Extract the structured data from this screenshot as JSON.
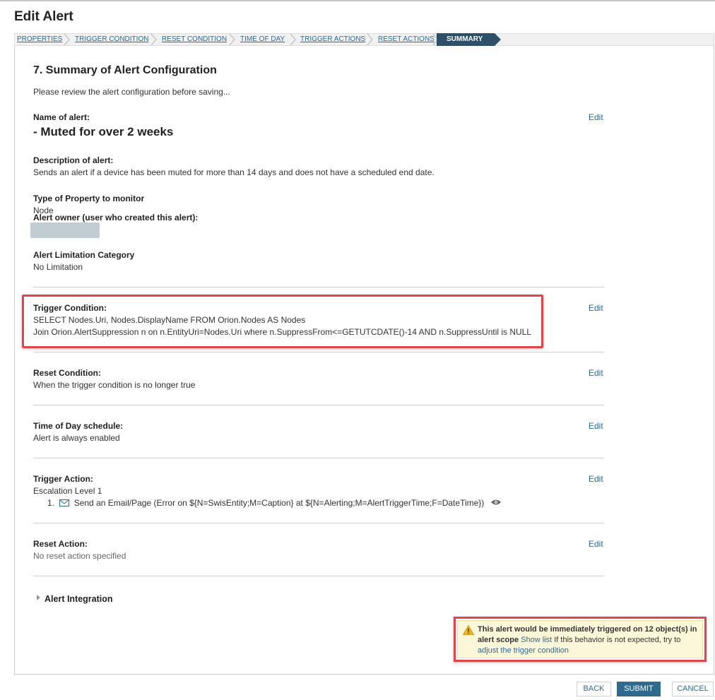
{
  "page": {
    "title": "Edit Alert"
  },
  "wizard": {
    "steps": [
      "PROPERTIES",
      "TRIGGER CONDITION",
      "RESET CONDITION",
      "TIME OF DAY",
      "TRIGGER ACTIONS",
      "RESET ACTIONS",
      "SUMMARY"
    ],
    "active_step": "SUMMARY"
  },
  "summary": {
    "heading": "7. Summary of Alert Configuration",
    "intro": "Please review the alert configuration before saving...",
    "edit_label": "Edit",
    "name": {
      "label": "Name of alert:",
      "value": "- Muted for over 2 weeks"
    },
    "description": {
      "label": "Description of alert:",
      "value": "Sends an alert if a device has been muted for more than 14 days and does not have a scheduled end date."
    },
    "property_type": {
      "label": "Type of Property to monitor",
      "value": "Node"
    },
    "owner": {
      "label": "Alert owner (user who created this alert):"
    },
    "limitation": {
      "label": "Alert Limitation Category",
      "value": "No Limitation"
    },
    "trigger_condition": {
      "label": "Trigger Condition:",
      "line1": "SELECT Nodes.Uri, Nodes.DisplayName FROM Orion.Nodes AS Nodes",
      "line2": "Join Orion.AlertSuppression n on n.EntityUri=Nodes.Uri where n.SuppressFrom<=GETUTCDATE()-14 AND n.SuppressUntil is NULL"
    },
    "reset_condition": {
      "label": "Reset Condition:",
      "value": "When the trigger condition is no longer true"
    },
    "time_of_day": {
      "label": "Time of Day schedule:",
      "value": "Alert is always enabled"
    },
    "trigger_action": {
      "label": "Trigger Action:",
      "level": "Escalation Level 1",
      "item_number": "1.",
      "item_text": "Send an Email/Page (Error on ${N=SwisEntity;M=Caption} at ${N=Alerting;M=AlertTriggerTime;F=DateTime})"
    },
    "reset_action": {
      "label": "Reset Action:",
      "value": "No reset action specified"
    },
    "integration": {
      "label": "Alert Integration"
    }
  },
  "warning": {
    "bold_text": "This alert would be immediately triggered on 12 object(s) in alert scope",
    "show_list": "Show list",
    "middle_text": " If this behavior is not expected, try to ",
    "adjust_link": "adjust the trigger condition"
  },
  "footer": {
    "back": "BACK",
    "submit": "SUBMIT",
    "cancel": "CANCEL"
  },
  "icons": {
    "mail": "envelope-icon",
    "eye": "eye-icon",
    "warning": "warning-triangle-icon",
    "expand": "chevron-right-icon"
  },
  "colors": {
    "link": "#296a9b",
    "active_step": "#2d4f69",
    "primary_button": "#2d6a8e",
    "highlight": "#e0474c",
    "warning_bg": "#fdf7d9"
  }
}
